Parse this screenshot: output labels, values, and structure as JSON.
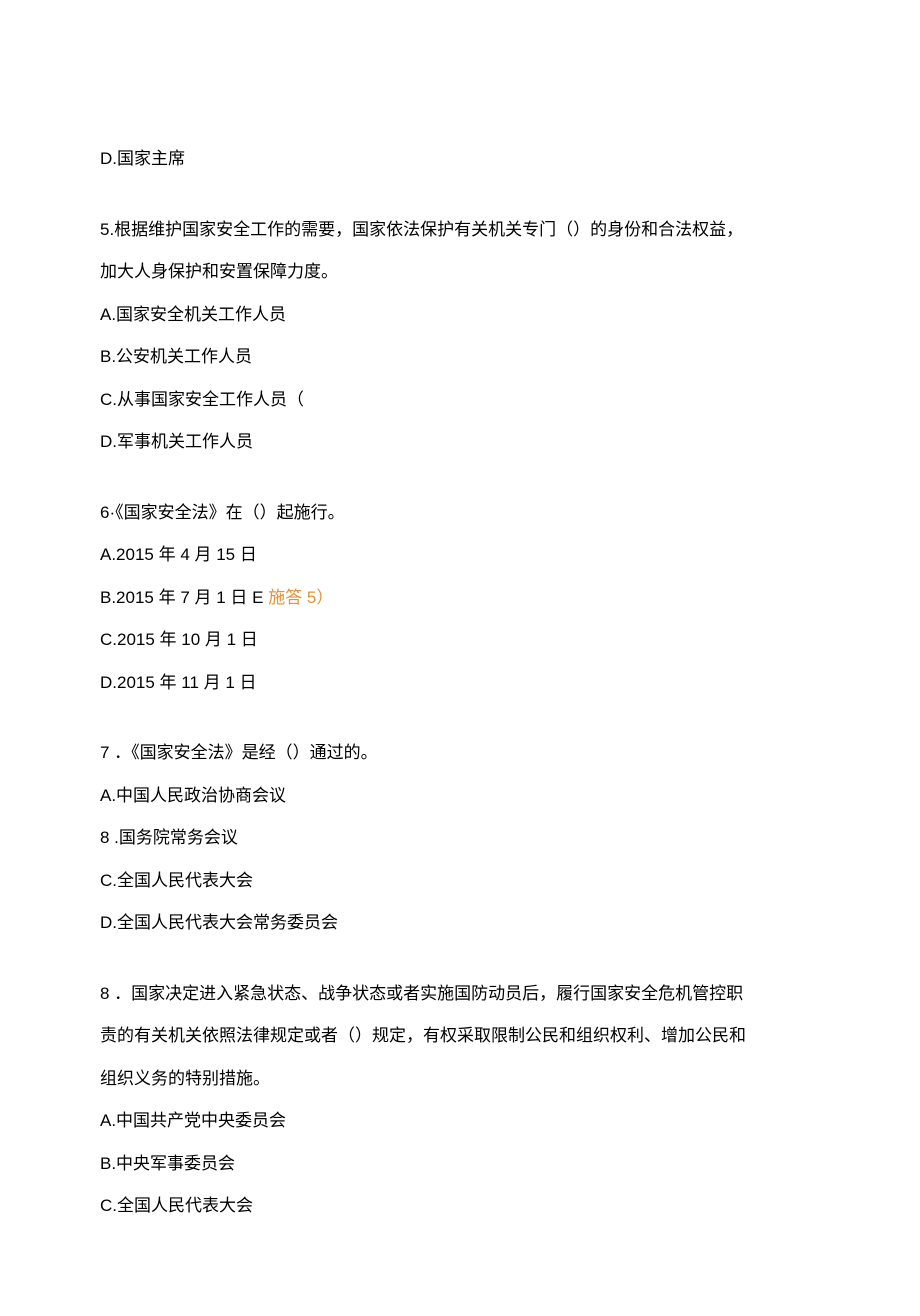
{
  "q4_optD": "D.国家主席",
  "q5_stem1": "5.根据维护国家安全工作的需要，国家依法保护有关机关专门（）的身份和合法权益，",
  "q5_stem2": "加大人身保护和安置保障力度。",
  "q5_A": "A.国家安全机关工作人员",
  "q5_B": "B.公安机关工作人员",
  "q5_C": "C.从事国家安全工作人员（",
  "q5_D": "D.军事机关工作人员",
  "q6_stem": "6·《国家安全法》在（）起施行。",
  "q6_A": "A.2015 年 4 月 15 日",
  "q6_B_prefix": "B.2015 年 7 月 1 日 E ",
  "q6_B_orange": "施答 5）",
  "q6_C": "C.2015 年 10 月 1 日",
  "q6_D": "D.2015 年 11 月 1 日",
  "q7_stem": "7 ．《国家安全法》是经（）通过的。",
  "q7_A": "A.中国人民政治协商会议",
  "q7_B": "8 .国务院常务会议",
  "q7_C": "C.全国人民代表大会",
  "q7_D": "D.全国人民代表大会常务委员会",
  "q8_stem1": "8 ．国家决定进入紧急状态、战争状态或者实施国防动员后，履行国家安全危机管控职",
  "q8_stem2": "责的有关机关依照法律规定或者（）规定，有权采取限制公民和组织权利、增加公民和",
  "q8_stem3": "组织义务的特别措施。",
  "q8_A": "A.中国共产党中央委员会",
  "q8_B": "B.中央军事委员会",
  "q8_C": "C.全国人民代表大会"
}
